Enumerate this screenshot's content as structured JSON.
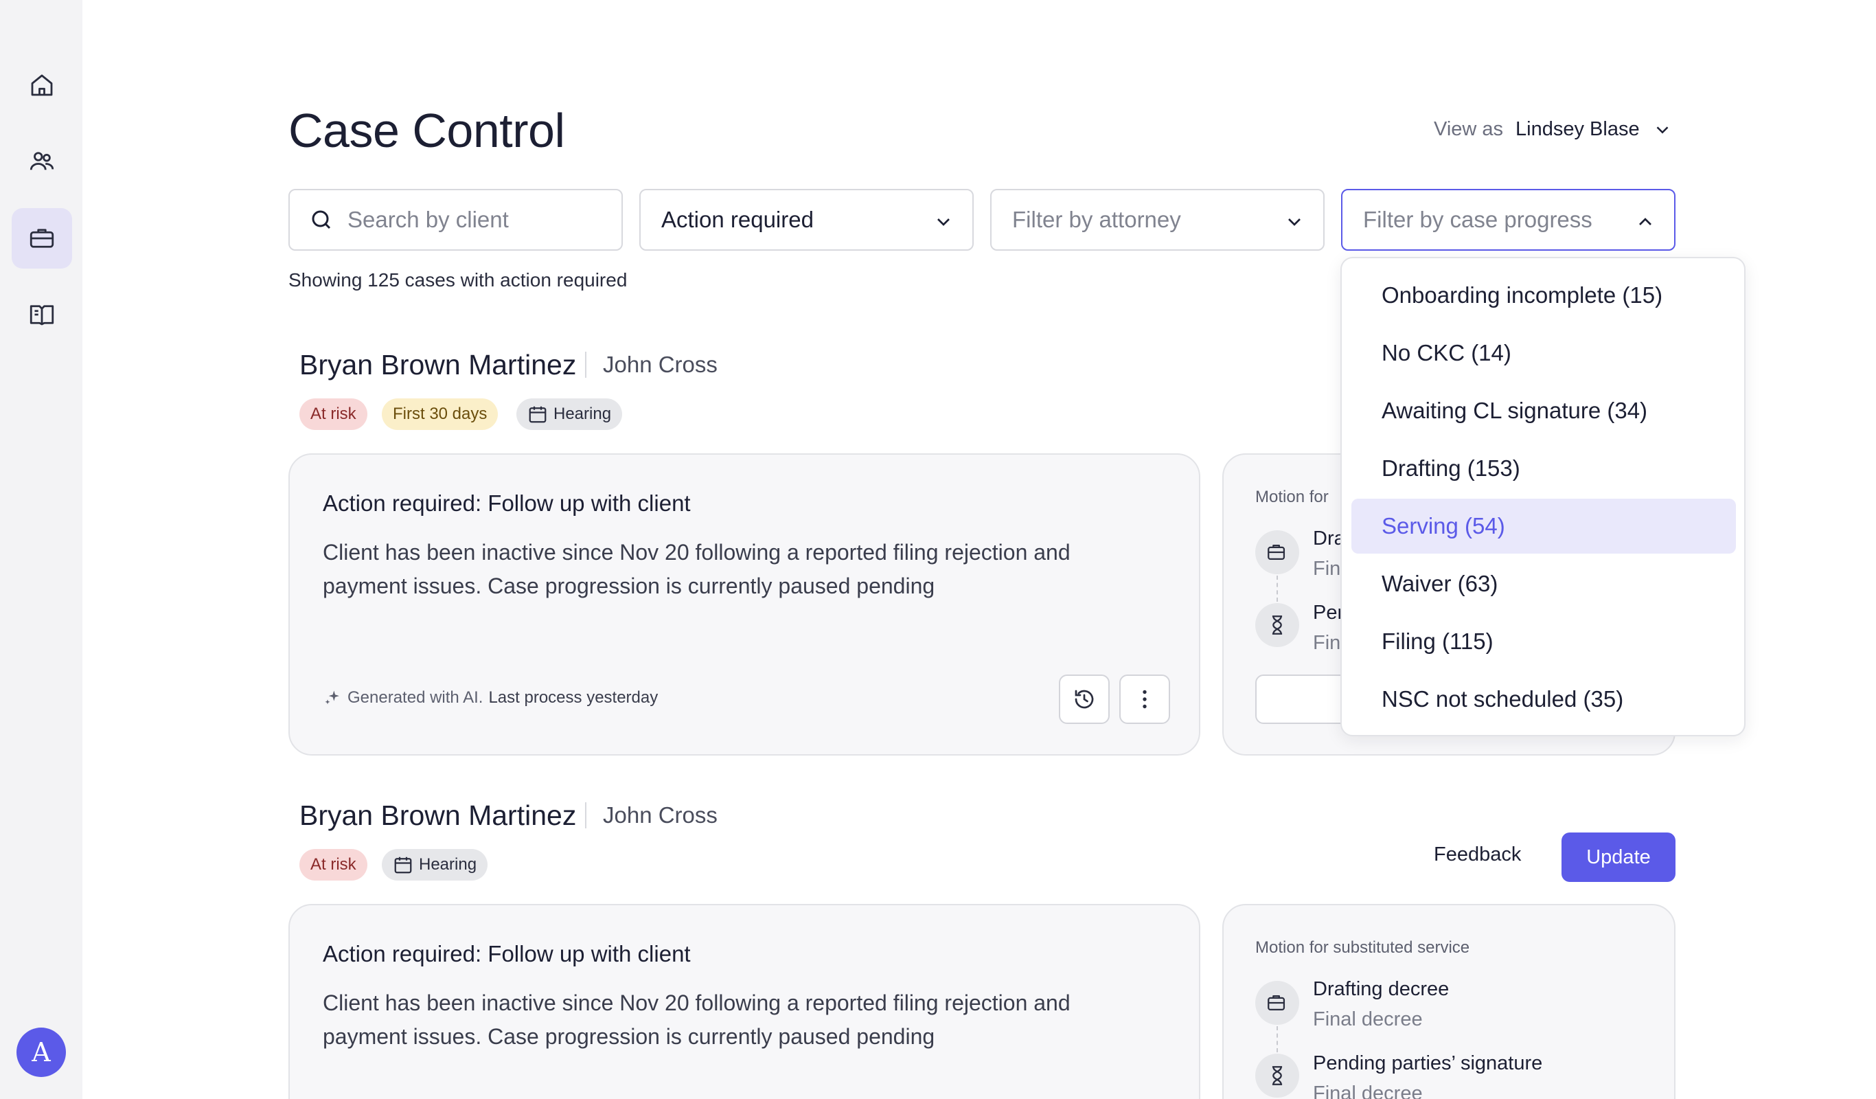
{
  "header": {
    "title": "Case Control",
    "view_as_label": "View as",
    "view_as_name": "Lindsey Blase"
  },
  "filters": {
    "search_placeholder": "Search by client",
    "action_value": "Action required",
    "attorney_placeholder": "Filter by attorney",
    "progress_placeholder": "Filter by case progress"
  },
  "summary": "Showing 125 cases with action required",
  "progress_dropdown": {
    "items": [
      {
        "label": "Onboarding incomplete (15)"
      },
      {
        "label": "No CKC (14)"
      },
      {
        "label": "Awaiting CL signature (34)"
      },
      {
        "label": "Drafting (153)"
      },
      {
        "label": "Serving (54)",
        "selected": true
      },
      {
        "label": "Waiver (63)"
      },
      {
        "label": "Filing (115)"
      },
      {
        "label": "NSC not scheduled  (35)"
      }
    ]
  },
  "cases": [
    {
      "client": "Bryan Brown Martinez",
      "attorney": "John Cross",
      "badges": [
        "At risk",
        "First 30 days",
        "Hearing"
      ],
      "action_title": "Action required: Follow up with client",
      "action_body_1": "Client has been inactive since Nov 20 following a reported filing rejection and",
      "action_body_2": "payment issues. Case progression is currently paused pending",
      "ai_label": "Generated with AI.",
      "ai_time": "Last process yesterday",
      "progress": {
        "subtitle": "Motion for",
        "step1_title": "Dra",
        "step1_sub": "Fin",
        "step2_title": "Pen",
        "step2_sub": "Fin"
      }
    },
    {
      "client": "Bryan Brown Martinez",
      "attorney": "John Cross",
      "badges": [
        "At risk",
        "Hearing"
      ],
      "feedback_label": "Feedback",
      "update_label": "Update",
      "action_title": "Action required: Follow up with client",
      "action_body_1": "Client has been inactive since Nov 20 following a reported filing rejection and",
      "action_body_2": "payment issues. Case progression is currently paused pending",
      "progress": {
        "subtitle": "Motion for substituted service",
        "step1_title": "Drafting decree",
        "step1_sub": "Final decree",
        "step2_title": "Pending parties’ signature",
        "step2_sub": "Final decree"
      }
    }
  ],
  "user": {
    "avatar_initial": "A"
  },
  "colors": {
    "accent": "#5b5ae8",
    "at_risk_bg": "#f8d8d8",
    "first30_bg": "#fbefc9"
  }
}
